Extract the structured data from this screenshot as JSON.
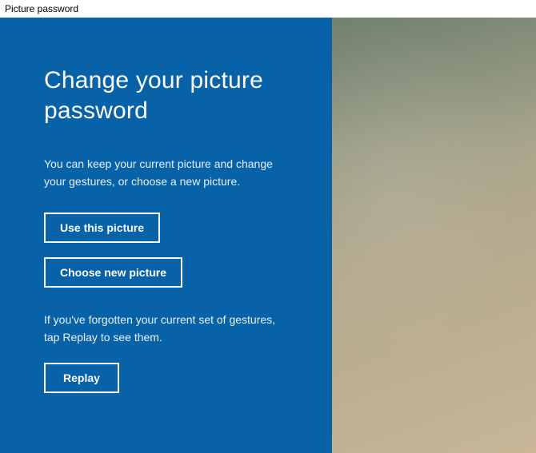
{
  "window": {
    "title": "Picture password"
  },
  "panel": {
    "heading": "Change your picture password",
    "description": "You can keep your current picture and change your gestures, or choose a new picture.",
    "use_picture_label": "Use this picture",
    "choose_picture_label": "Choose new picture",
    "replay_description": "If you've forgotten your current set of gestures, tap Replay to see them.",
    "replay_label": "Replay"
  }
}
